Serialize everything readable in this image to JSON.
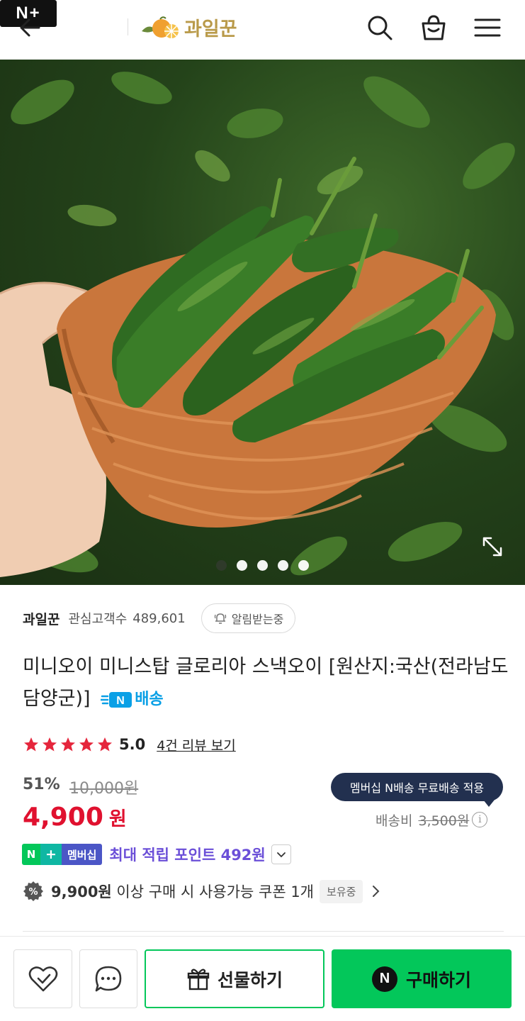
{
  "header": {
    "brand_badge": "N+",
    "brand_name": "과일꾼"
  },
  "gallery": {
    "image_desc": "mini cucumbers in wicker basket",
    "slide_count": 5,
    "active_slide": 1
  },
  "store": {
    "name": "과일꾼",
    "fans_label": "관심고객수",
    "fans_count": "489,601",
    "alarm_label": "알림받는중"
  },
  "product": {
    "title": "미니오이 미니스탑 글로리아 스낵오이 [원산지:국산(전라남도 담양군)]",
    "delivery_badge": "배송",
    "rating": "5.0",
    "stars": 5,
    "review_link": "4건 리뷰 보기"
  },
  "pricing": {
    "discount": "51%",
    "original_price": "10,000원",
    "price": "4,900",
    "price_unit": "원",
    "shipping_tip": "멤버십 N배송 무료배송 적용",
    "shipping_label": "배송비",
    "shipping_original": "3,500원",
    "info_icon": "i"
  },
  "membership": {
    "badge_n": "N",
    "badge_plus": "+",
    "badge_text": "멤버십",
    "points_text": "최대 적립 포인트 492원"
  },
  "coupon": {
    "text_bold": "9,900원",
    "text_rest": " 이상 구매 시 사용가능 쿠폰 1개",
    "badge": "보유중"
  },
  "bottom_bar": {
    "gift_label": "선물하기",
    "buy_icon": "N",
    "buy_label": "구매하기"
  },
  "colors": {
    "price_red": "#e0112f",
    "naver_green": "#03c75a",
    "tooltip_navy": "#22304f",
    "member_purple": "#6b4fd8"
  }
}
